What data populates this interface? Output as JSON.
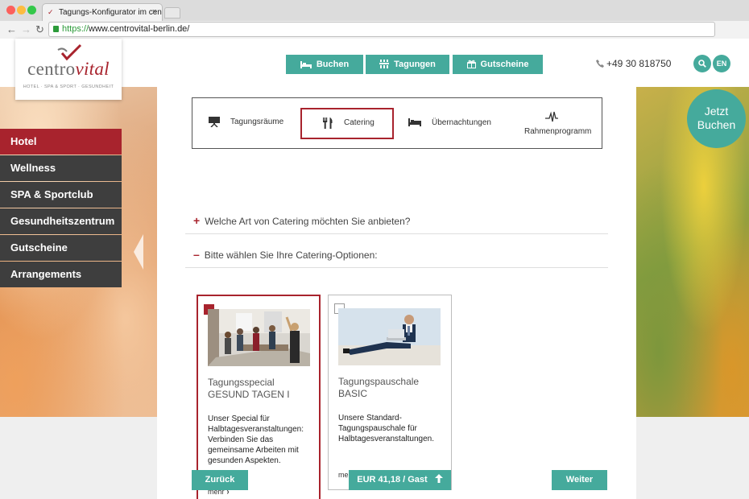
{
  "browser": {
    "tab_title": "Tagungs-Konfigurator im centr",
    "url_scheme": "https://",
    "url_rest": "www.centrovital-berlin.de/"
  },
  "logo": {
    "brand_part1": "centro",
    "brand_part2": "vital",
    "tagline": "HOTEL · SPA & SPORT · GESUNDHEIT"
  },
  "topnav": {
    "buchen": "Buchen",
    "tagungen": "Tagungen",
    "gutscheine": "Gutscheine",
    "phone": "+49 30 818750",
    "lang": "EN"
  },
  "cta": {
    "line1": "Jetzt",
    "line2": "Buchen"
  },
  "sidebar": {
    "items": [
      {
        "label": "Hotel",
        "active": true
      },
      {
        "label": "Wellness",
        "active": false
      },
      {
        "label": "SPA & Sportclub",
        "active": false
      },
      {
        "label": "Gesundheitszentrum",
        "active": false
      },
      {
        "label": "Gutscheine",
        "active": false
      },
      {
        "label": "Arrangements",
        "active": false
      }
    ]
  },
  "categories": {
    "items": [
      {
        "label": "Tagungsräume",
        "icon": "presentation-board-icon"
      },
      {
        "label": "Catering",
        "icon": "cutlery-icon",
        "selected": true
      },
      {
        "label": "Übernachtungen",
        "icon": "bed-icon"
      },
      {
        "label": "Rahmenprogramm",
        "icon": "activity-icon"
      }
    ]
  },
  "accordion": {
    "q1": "Welche Art von Catering möchten Sie anbieten?",
    "q1_sign": "+",
    "q2": "Bitte wählen Sie Ihre Catering-Optionen:",
    "q2_sign": "–"
  },
  "cards": [
    {
      "title": "Tagungsspecial GESUND TAGEN I",
      "description": "Unser Special für Halbtagesveranstaltungen: Verbinden Sie das gemeinsame Arbeiten mit gesunden Aspekten.",
      "more": "mehr",
      "selected": true
    },
    {
      "title": "Tagungspauschale BASIC",
      "description": "Unsere Standard-Tagungspauschale für Halbtagesveranstaltungen.",
      "more": "mehr",
      "selected": false
    }
  ],
  "footer": {
    "back": "Zurück",
    "price": "EUR 41,18 / Gast",
    "next": "Weiter"
  },
  "colors": {
    "teal": "#45aa9c",
    "brand_red": "#a8232d",
    "nav_dark": "#3e3e3e"
  }
}
